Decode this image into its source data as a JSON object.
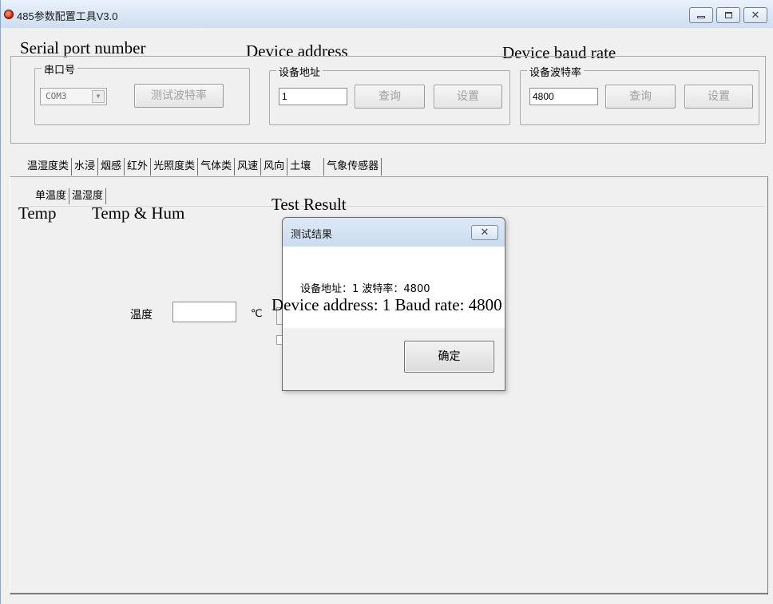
{
  "window": {
    "title": "485参数配置工具V3.0",
    "buttons": [
      "minimize",
      "maximize",
      "close"
    ]
  },
  "captions": {
    "serial_port": "Serial port number",
    "device_address": "Device address",
    "device_baud": "Device baud rate",
    "temp": "Temp",
    "temp_hum": "Temp & Hum",
    "test_result": "Test Result",
    "dialog_translation": "Device address: 1 Baud rate: 4800"
  },
  "serial_group": {
    "legend": "串口号",
    "combo_value": "COM3",
    "test_button": "测试波特率"
  },
  "address_group": {
    "legend": "设备地址",
    "value": "1",
    "query_button": "查询",
    "set_button": "设置"
  },
  "baud_group": {
    "legend": "设备波特率",
    "value": "4800",
    "query_button": "查询",
    "set_button": "设置"
  },
  "tabs": [
    "温湿度类",
    "水浸",
    "烟感",
    "红外",
    "光照度类",
    "气体类",
    "风速",
    "风向",
    "土壤",
    "气象传感器"
  ],
  "inner_tabs": [
    "单温度",
    "温湿度"
  ],
  "temp_field": {
    "label": "温度",
    "unit": "℃",
    "value": ""
  },
  "dialog": {
    "title": "测试结果",
    "message": "设备地址：1  波特率：4800",
    "ok_button": "确定",
    "close_glyph": "✕"
  },
  "colors": {
    "window_bg": "#f0f0f0",
    "titlebar": "#dbe7f5",
    "border": "#a9a9a9",
    "dialog_body": "#ffffff"
  }
}
